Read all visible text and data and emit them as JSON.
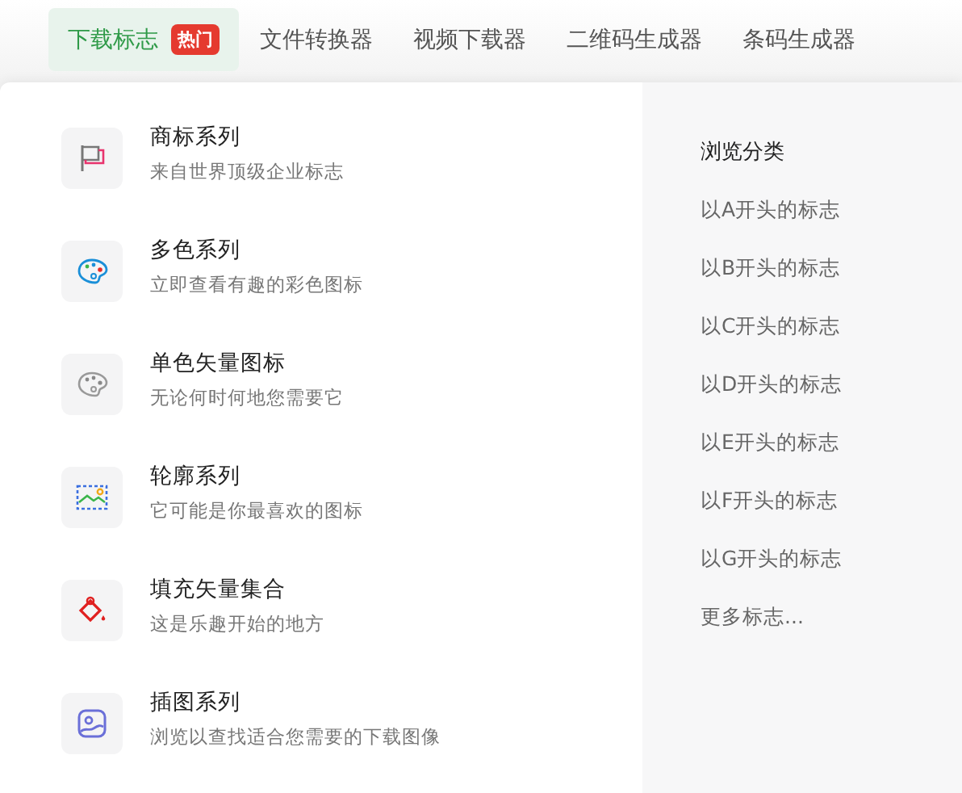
{
  "nav_tabs": [
    {
      "label": "下载标志",
      "selected": true,
      "badge": "热门"
    },
    {
      "label": "文件转换器",
      "selected": false
    },
    {
      "label": "视频下载器",
      "selected": false
    },
    {
      "label": "二维码生成器",
      "selected": false
    },
    {
      "label": "条码生成器",
      "selected": false
    }
  ],
  "menu_items": [
    {
      "kind": "flag",
      "title": "商标系列",
      "description": "来自世界顶级企业标志"
    },
    {
      "kind": "palette-color",
      "title": "多色系列",
      "description": "立即查看有趣的彩色图标"
    },
    {
      "kind": "palette-mono",
      "title": "单色矢量图标",
      "description": "无论何时何地您需要它"
    },
    {
      "kind": "image-outline",
      "title": "轮廓系列",
      "description": "它可能是你最喜欢的图标"
    },
    {
      "kind": "paint-bucket",
      "title": "填充矢量集合",
      "description": "这是乐趣开始的地方"
    },
    {
      "kind": "illustration",
      "title": "插图系列",
      "description": "浏览以查找适合您需要的下载图像"
    }
  ],
  "browse": {
    "heading": "浏览分类",
    "links": [
      "以A开头的标志",
      "以B开头的标志",
      "以C开头的标志",
      "以D开头的标志",
      "以E开头的标志",
      "以F开头的标志",
      "以G开头的标志",
      "更多标志..."
    ]
  }
}
